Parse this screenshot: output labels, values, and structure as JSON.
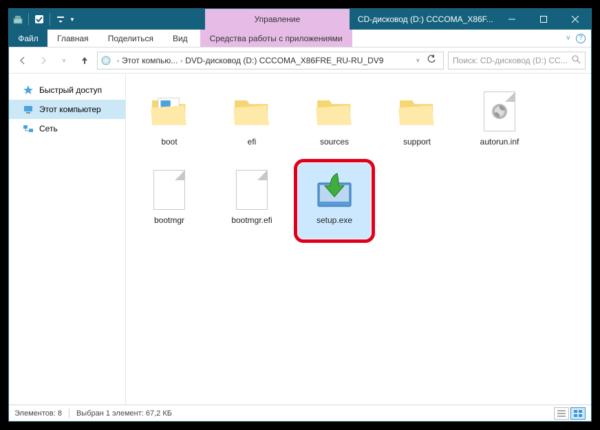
{
  "titlebar": {
    "context_tab": "Управление",
    "title": "CD-дисковод (D:) CCCOMA_X86F..."
  },
  "ribbon": {
    "file": "Файл",
    "tabs": [
      "Главная",
      "Поделиться",
      "Вид"
    ],
    "context": "Средства работы с приложениями"
  },
  "breadcrumb": {
    "seg1": "Этот компью...",
    "seg2": "DVD-дисковод (D:) CCCOMA_X86FRE_RU-RU_DV9"
  },
  "search": {
    "placeholder": "Поиск: CD-дисковод (D:) CC..."
  },
  "sidebar": {
    "items": [
      {
        "label": "Быстрый доступ"
      },
      {
        "label": "Этот компьютер"
      },
      {
        "label": "Сеть"
      }
    ]
  },
  "files": [
    {
      "name": "boot",
      "type": "folder-open"
    },
    {
      "name": "efi",
      "type": "folder"
    },
    {
      "name": "sources",
      "type": "folder"
    },
    {
      "name": "support",
      "type": "folder"
    },
    {
      "name": "autorun.inf",
      "type": "inf"
    },
    {
      "name": "bootmgr",
      "type": "blank"
    },
    {
      "name": "bootmgr.efi",
      "type": "blank"
    },
    {
      "name": "setup.exe",
      "type": "setup",
      "selected": true,
      "highlighted": true
    }
  ],
  "status": {
    "left": "Элементов: 8",
    "mid": "Выбран 1 элемент: 67,2 КБ"
  }
}
